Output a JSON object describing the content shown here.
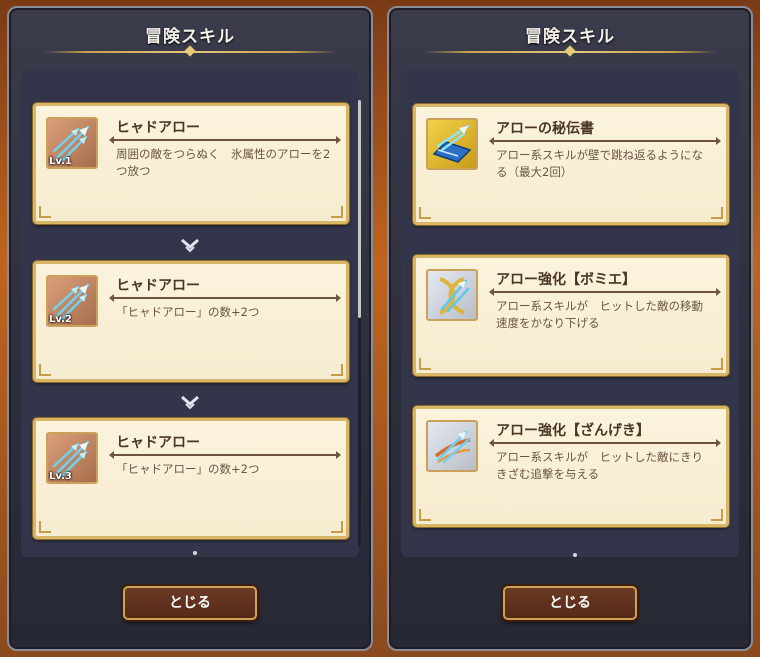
{
  "left_panel": {
    "title": "冒険スキル",
    "cards": [
      {
        "name": "ヒャドアロー",
        "level": "Lv.1",
        "description": "周囲の敵をつらぬく　氷属性のアローを2つ放つ",
        "icon": "ice-arrow-icon"
      },
      {
        "name": "ヒャドアロー",
        "level": "Lv.2",
        "description": "「ヒャドアロー」の数+2つ",
        "icon": "ice-arrow-icon"
      },
      {
        "name": "ヒャドアロー",
        "level": "Lv.3",
        "description": "「ヒャドアロー」の数+2つ",
        "icon": "ice-arrow-icon"
      }
    ],
    "close_label": "とじる"
  },
  "right_panel": {
    "title": "冒険スキル",
    "cards": [
      {
        "name": "アローの秘伝書",
        "description": "アロー系スキルが壁で跳ね返るようになる（最大2回）",
        "icon": "arrow-scroll-icon"
      },
      {
        "name": "アロー強化【ボミエ】",
        "description": "アロー系スキルが　ヒットした敵の移動速度をかなり下げる",
        "icon": "slow-arrow-icon"
      },
      {
        "name": "アロー強化【ざんげき】",
        "description": "アロー系スキルが　ヒットした敵にきりきざむ追撃を与える",
        "icon": "slash-arrow-icon"
      }
    ],
    "close_label": "とじる"
  },
  "colors": {
    "panel_bg": "#2c2e3c",
    "card_bg": "#fbf3dc",
    "card_border": "#d9b566",
    "button_bg": "#5e3220"
  }
}
